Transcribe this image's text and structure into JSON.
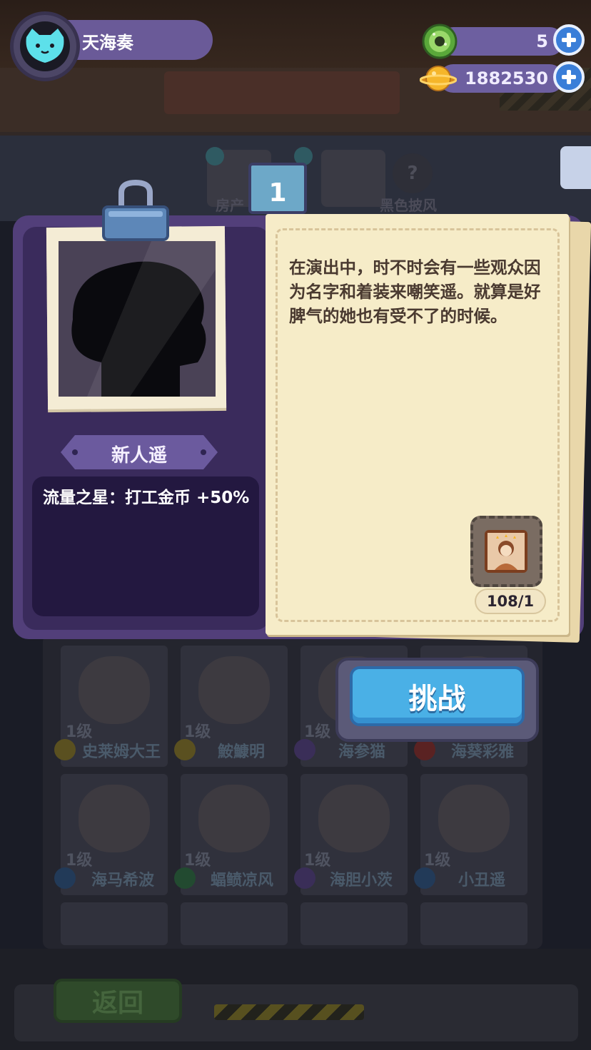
{
  "player": {
    "name": "天海奏"
  },
  "resources": [
    {
      "icon": "donut-icon",
      "value": "5",
      "color": "#7bc94a"
    },
    {
      "icon": "planet-coin-icon",
      "value": "1882530",
      "color": "#f5b62a"
    }
  ],
  "background_tabs": [
    "房产",
    "黑色披风"
  ],
  "card": {
    "tab_number": "1",
    "character_name": "新人遥",
    "skill": "流量之星：打工金币 +50%",
    "story": "在演出中，时不时会有一些观众因为名字和着装来嘲笑遥。就算是好脾气的她也有受不了的时候。",
    "item": {
      "icon": "character-photo-icon",
      "count": "108/1"
    },
    "challenge_label": "挑战"
  },
  "roster": [
    {
      "level": "1级",
      "name": "史莱姆大王",
      "badge": "#8a7a2a"
    },
    {
      "level": "1级",
      "name": "鮟鱇明",
      "badge": "#8a7a2a"
    },
    {
      "level": "1级",
      "name": "海参猫",
      "badge": "#4a3a6a"
    },
    {
      "level": "1级",
      "name": "海葵彩雅",
      "badge": "#6a2a2a"
    },
    {
      "level": "1级",
      "name": "海马希波",
      "badge": "#2a4a6a"
    },
    {
      "level": "1级",
      "name": "蝠鲼凉风",
      "badge": "#2a5a3a"
    },
    {
      "level": "1级",
      "name": "海胆小茨",
      "badge": "#4a3a6a"
    },
    {
      "level": "1级",
      "name": "小丑遥",
      "badge": "#2a4a6a"
    }
  ],
  "back_label": "返回",
  "colors": {
    "accent": "#4ab0e6",
    "panel": "#523f7a",
    "paper": "#f6ecc8"
  }
}
